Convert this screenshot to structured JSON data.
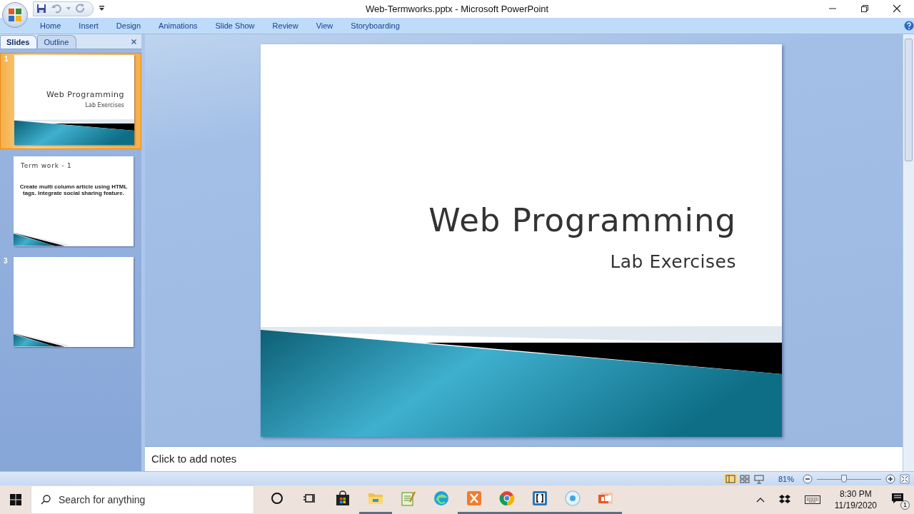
{
  "window": {
    "title": "Web-Termworks.pptx - Microsoft PowerPoint"
  },
  "ribbon_tabs": [
    "Home",
    "Insert",
    "Design",
    "Animations",
    "Slide Show",
    "Review",
    "View",
    "Storyboarding"
  ],
  "panel_tabs": [
    {
      "label": "Slides",
      "selected": true
    },
    {
      "label": "Outline",
      "selected": false
    }
  ],
  "slides": [
    {
      "number": "1",
      "selected": true,
      "kind": "title",
      "title": "Web Programming",
      "subtitle": "Lab Exercises"
    },
    {
      "selected": false,
      "kind": "content",
      "title": "Term work - 1",
      "body": "Create multi column article using HTML tags. Integrate social sharing feature."
    },
    {
      "number": "3",
      "selected": false,
      "kind": "blank"
    }
  ],
  "current_slide": {
    "kind": "title",
    "title": "Web Programming",
    "subtitle": "Lab Exercises"
  },
  "notes": {
    "placeholder": "Click to add notes"
  },
  "status_bar": {
    "zoom": "81%",
    "zoom_slider": {
      "level": 0.42
    }
  },
  "taskbar": {
    "search": {
      "placeholder": "Search for anything"
    },
    "apps": [
      {
        "kind": "cortana",
        "running": false
      },
      {
        "kind": "task-view",
        "running": false
      },
      {
        "kind": "store",
        "running": false
      },
      {
        "kind": "folder",
        "running": true
      },
      {
        "kind": "notepad",
        "running": false
      },
      {
        "kind": "edge",
        "running": false
      },
      {
        "kind": "xampp",
        "running": true
      },
      {
        "kind": "chrome",
        "running": true
      },
      {
        "kind": "brackets",
        "running": true
      },
      {
        "kind": "recorder",
        "running": true
      },
      {
        "kind": "powerpoint",
        "running": true
      }
    ],
    "time": "8:30 PM",
    "date": "11/19/2020",
    "notification_count": "1"
  }
}
